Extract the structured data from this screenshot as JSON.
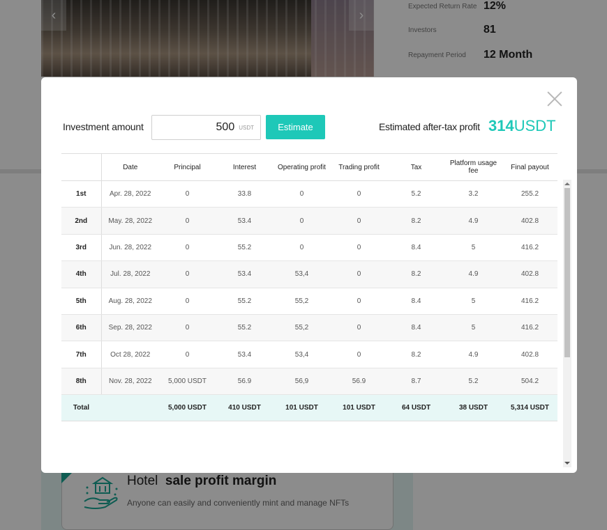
{
  "background": {
    "stats": [
      {
        "label": "Expected Return Rate",
        "value": "12%"
      },
      {
        "label": "Investors",
        "value": "81"
      },
      {
        "label": "Repayment Period",
        "value": "12 Month"
      }
    ],
    "promo": {
      "title_plain": "Hotel",
      "title_bold": "sale profit margin",
      "subtitle": "Anyone can easily and conveniently mint and manage NFTs"
    },
    "icons": {
      "prev": "chevron-left-icon",
      "next": "chevron-right-icon",
      "promo": "hotel-hand-icon"
    }
  },
  "modal": {
    "amount_label": "Investment amount",
    "amount_value": "500",
    "amount_unit": "USDT",
    "estimate_label": "Estimate",
    "profit_label": "Estimated after-tax profit",
    "profit_number": "314",
    "profit_unit": "USDT",
    "accent_color": "#1ec8b8",
    "table": {
      "headers": [
        "",
        "Date",
        "Principal",
        "Interest",
        "Operating profit",
        "Trading profit",
        "Tax",
        "Platform usage fee",
        "Final payout"
      ],
      "rows": [
        [
          "1st",
          "Apr. 28, 2022",
          "0",
          "33.8",
          "0",
          "0",
          "5.2",
          "3.2",
          "255.2"
        ],
        [
          "2nd",
          "May. 28, 2022",
          "0",
          "53.4",
          "0",
          "0",
          "8.2",
          "4.9",
          "402.8"
        ],
        [
          "3rd",
          "Jun. 28, 2022",
          "0",
          "55.2",
          "0",
          "0",
          "8.4",
          "5",
          "416.2"
        ],
        [
          "4th",
          "Jul. 28, 2022",
          "0",
          "53.4",
          "53,4",
          "0",
          "8.2",
          "4.9",
          "402.8"
        ],
        [
          "5th",
          "Aug. 28, 2022",
          "0",
          "55.2",
          "55,2",
          "0",
          "8.4",
          "5",
          "416.2"
        ],
        [
          "6th",
          "Sep. 28, 2022",
          "0",
          "55.2",
          "55,2",
          "0",
          "8.4",
          "5",
          "416.2"
        ],
        [
          "7th",
          "Oct 28, 2022",
          "0",
          "53.4",
          "53,4",
          "0",
          "8.2",
          "4.9",
          "402.8"
        ],
        [
          "8th",
          "Nov. 28, 2022",
          "5,000 USDT",
          "56.9",
          "56,9",
          "56.9",
          "8.7",
          "5.2",
          "504.2"
        ]
      ],
      "total": [
        "Total",
        "",
        "5,000 USDT",
        "410 USDT",
        "101 USDT",
        "101 USDT",
        "64 USDT",
        "38 USDT",
        "5,314 USDT"
      ]
    }
  }
}
